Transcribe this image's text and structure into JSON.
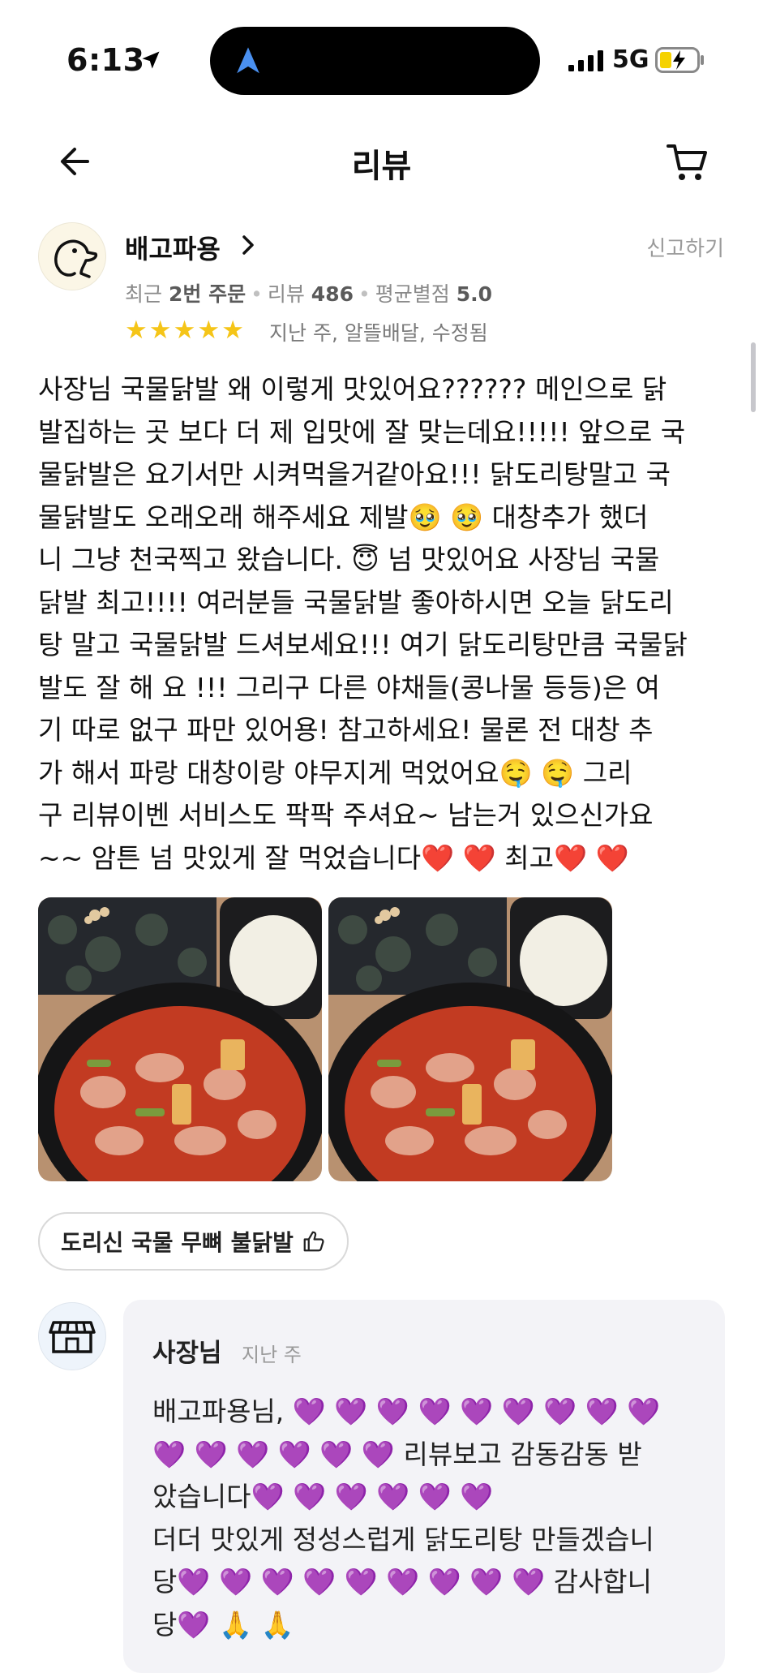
{
  "status_bar": {
    "time": "6:13",
    "network": "5G"
  },
  "header": {
    "title": "리뷰"
  },
  "review": {
    "reviewer_name": "배고파용",
    "report_label": "신고하기",
    "meta": {
      "recent_prefix": "최근",
      "recent_orders": "2번 주문",
      "review_label": "리뷰",
      "review_count": "486",
      "avg_label": "평균별점",
      "avg_rating": "5.0"
    },
    "stars": 5,
    "rating_meta": "지난 주, 알뜰배달, 수정됨",
    "text": "사장님 국물닭발 왜 이렇게 맛있어요?????? 메인으로 닭\n발집하는 곳 보다 더 제 입맛에 잘 맞는데요!!!!! 앞으로 국\n물닭발은 요기서만 시켜먹을거같아요!!! 닭도리탕말고 국\n물닭발도 오래오래 해주세요 제발🥹 🥹  대창추가 했더\n니 그냥 천국찍고 왔습니다. 😇  넘 맛있어요 사장님 국물\n닭발 최고!!!! 여러분들 국물닭발 좋아하시면 오늘 닭도리\n탕 말고 국물닭발 드셔보세요!!! 여기 닭도리탕만큼 국물닭\n발도 잘 해 요 !!! 그리구 다른 야채들(콩나물 등등)은 여\n기 따로 없구 파만 있어용! 참고하세요! 물론 전 대창 추\n가 해서 파랑 대창이랑 야무지게 먹었어요🤤 🤤  그리\n구 리뷰이벤 서비스도 팍팍 주셔요~ 남는거 있으신가요\n~~ 암튼 넘 맛있게 잘 먹었습니다❤️ ❤️  최고❤️ ❤️",
    "menu_tag": "도리신 국물 무뼈 불닭발"
  },
  "owner_reply": {
    "name": "사장님",
    "time": "지난 주",
    "text": "배고파용님, 💜 💜 💜 💜 💜 💜 💜 💜 💜\n💜 💜 💜 💜 💜 💜  리뷰보고 감동감동 받\n았습니다💜 💜 💜 💜 💜 💜\n더더 맛있게 정성스럽게 닭도리탕 만들겠습니\n당💜 💜 💜 💜 💜 💜 💜 💜 💜  감사합니\n당💜 🙏 🙏"
  },
  "colors": {
    "star": "#f5c518",
    "reply_bg": "#f3f3f7",
    "muted_text": "#8a8a8a"
  },
  "icons": [
    "location-arrow-icon",
    "app-icon",
    "signal-icon",
    "battery-icon",
    "back-arrow-icon",
    "cart-icon",
    "chevron-right-icon",
    "star-icon",
    "thumbs-up-icon",
    "store-icon"
  ]
}
